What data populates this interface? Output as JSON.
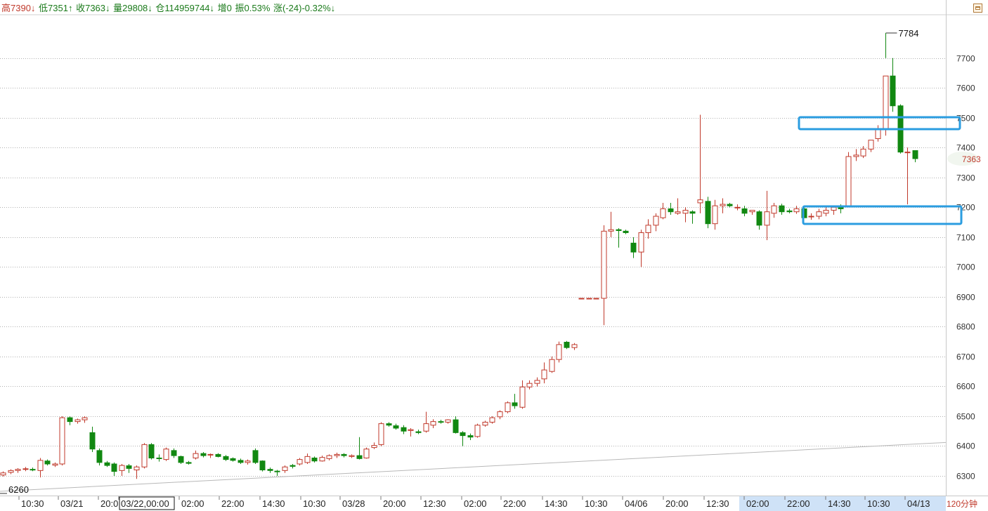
{
  "info": {
    "high_label": "高7390↓",
    "low_label": "低7351↑",
    "close_label": "收7363↓",
    "volume_label": "量29808↓",
    "position_label": "仓114959744↓",
    "increase_label": "增0",
    "amplitude_label": "振0.53%",
    "change_label": "涨(-24)-0.32%↓"
  },
  "period_label": "120分钟",
  "colors": {
    "up": "#c0392b",
    "down": "#118811",
    "highlight": "#2b9de0",
    "grid": "#b0b0b0"
  },
  "chart_data": {
    "type": "candlestick",
    "ylim": [
      6280,
      7820
    ],
    "y_ticks": [
      6300,
      6400,
      6500,
      6600,
      6700,
      6800,
      6900,
      7000,
      7100,
      7200,
      7300,
      7400,
      7500,
      7600,
      7700
    ],
    "x_tick_labels": [
      "10:30",
      "03/21",
      "20:0",
      "03/22,00:00",
      "02:00",
      "22:00",
      "14:30",
      "10:30",
      "03/28",
      "20:00",
      "12:30",
      "02:00",
      "22:00",
      "14:30",
      "10:30",
      "04/06",
      "20:00",
      "12:30",
      "02:00",
      "22:00",
      "14:30",
      "10:30",
      "04/13"
    ],
    "selected_x_label": "03/22,00:00",
    "annotations": {
      "max_label": "7784",
      "min_label": "6260",
      "last_price_label": "7363"
    },
    "last_price": 7363,
    "max_price": 7784,
    "min_price": 6260,
    "candles": [
      [
        6303,
        6315,
        6298,
        6310
      ],
      [
        6312,
        6322,
        6306,
        6318
      ],
      [
        6318,
        6326,
        6310,
        6322
      ],
      [
        6322,
        6330,
        6316,
        6324
      ],
      [
        6322,
        6328,
        6316,
        6320
      ],
      [
        6318,
        6360,
        6295,
        6352
      ],
      [
        6350,
        6355,
        6335,
        6340
      ],
      [
        6336,
        6345,
        6330,
        6340
      ],
      [
        6340,
        6500,
        6335,
        6495
      ],
      [
        6495,
        6500,
        6470,
        6482
      ],
      [
        6482,
        6492,
        6475,
        6488
      ],
      [
        6488,
        6500,
        6478,
        6495
      ],
      [
        6445,
        6465,
        6380,
        6390
      ],
      [
        6385,
        6392,
        6335,
        6345
      ],
      [
        6344,
        6350,
        6330,
        6335
      ],
      [
        6340,
        6345,
        6300,
        6315
      ],
      [
        6318,
        6340,
        6300,
        6335
      ],
      [
        6334,
        6340,
        6310,
        6325
      ],
      [
        6320,
        6335,
        6290,
        6330
      ],
      [
        6330,
        6410,
        6325,
        6405
      ],
      [
        6405,
        6410,
        6355,
        6360
      ],
      [
        6360,
        6372,
        6348,
        6358
      ],
      [
        6355,
        6395,
        6350,
        6390
      ],
      [
        6385,
        6392,
        6360,
        6368
      ],
      [
        6365,
        6368,
        6340,
        6345
      ],
      [
        6345,
        6350,
        6338,
        6342
      ],
      [
        6360,
        6385,
        6355,
        6375
      ],
      [
        6375,
        6380,
        6362,
        6368
      ],
      [
        6370,
        6375,
        6360,
        6372
      ],
      [
        6372,
        6376,
        6362,
        6365
      ],
      [
        6365,
        6370,
        6350,
        6355
      ],
      [
        6358,
        6362,
        6348,
        6352
      ],
      [
        6352,
        6358,
        6340,
        6345
      ],
      [
        6345,
        6355,
        6338,
        6350
      ],
      [
        6385,
        6392,
        6340,
        6345
      ],
      [
        6350,
        6352,
        6315,
        6320
      ],
      [
        6322,
        6328,
        6310,
        6318
      ],
      [
        6316,
        6320,
        6300,
        6315
      ],
      [
        6318,
        6335,
        6310,
        6330
      ],
      [
        6335,
        6340,
        6325,
        6332
      ],
      [
        6340,
        6360,
        6335,
        6355
      ],
      [
        6345,
        6375,
        6340,
        6365
      ],
      [
        6360,
        6365,
        6345,
        6350
      ],
      [
        6350,
        6368,
        6348,
        6362
      ],
      [
        6358,
        6372,
        6352,
        6368
      ],
      [
        6368,
        6378,
        6360,
        6372
      ],
      [
        6372,
        6376,
        6362,
        6368
      ],
      [
        6365,
        6372,
        6360,
        6368
      ],
      [
        6368,
        6430,
        6355,
        6358
      ],
      [
        6360,
        6395,
        6358,
        6390
      ],
      [
        6395,
        6412,
        6390,
        6402
      ],
      [
        6405,
        6480,
        6400,
        6475
      ],
      [
        6475,
        6480,
        6465,
        6470
      ],
      [
        6468,
        6475,
        6455,
        6460
      ],
      [
        6462,
        6470,
        6440,
        6450
      ],
      [
        6452,
        6460,
        6432,
        6455
      ],
      [
        6448,
        6455,
        6440,
        6445
      ],
      [
        6450,
        6515,
        6445,
        6475
      ],
      [
        6470,
        6490,
        6460,
        6482
      ],
      [
        6482,
        6488,
        6475,
        6480
      ],
      [
        6480,
        6490,
        6475,
        6488
      ],
      [
        6488,
        6500,
        6442,
        6445
      ],
      [
        6445,
        6450,
        6400,
        6435
      ],
      [
        6435,
        6442,
        6420,
        6430
      ],
      [
        6432,
        6475,
        6428,
        6470
      ],
      [
        6470,
        6485,
        6465,
        6480
      ],
      [
        6480,
        6500,
        6475,
        6495
      ],
      [
        6498,
        6520,
        6490,
        6515
      ],
      [
        6515,
        6550,
        6510,
        6545
      ],
      [
        6545,
        6575,
        6525,
        6535
      ],
      [
        6530,
        6620,
        6525,
        6598
      ],
      [
        6598,
        6620,
        6590,
        6610
      ],
      [
        6610,
        6630,
        6600,
        6620
      ],
      [
        6625,
        6680,
        6610,
        6655
      ],
      [
        6650,
        6700,
        6645,
        6690
      ],
      [
        6690,
        6750,
        6680,
        6740
      ],
      [
        6748,
        6752,
        6725,
        6730
      ],
      [
        6730,
        6745,
        6722,
        6740
      ],
      [
        6895,
        6895,
        6895,
        6895
      ],
      [
        6895,
        6895,
        6895,
        6895
      ],
      [
        6895,
        6895,
        6895,
        6895
      ],
      [
        6895,
        7140,
        6805,
        7120
      ],
      [
        7120,
        7185,
        7100,
        7125
      ],
      [
        7125,
        7130,
        7065,
        7122
      ],
      [
        7120,
        7125,
        7110,
        7115
      ],
      [
        7080,
        7100,
        7030,
        7050
      ],
      [
        7050,
        7125,
        7000,
        7115
      ],
      [
        7115,
        7160,
        7095,
        7140
      ],
      [
        7140,
        7180,
        7120,
        7170
      ],
      [
        7165,
        7215,
        7160,
        7195
      ],
      [
        7195,
        7215,
        7175,
        7185
      ],
      [
        7180,
        7230,
        7175,
        7185
      ],
      [
        7180,
        7200,
        7150,
        7190
      ],
      [
        7185,
        7190,
        7145,
        7180
      ],
      [
        7215,
        7510,
        7180,
        7225
      ],
      [
        7220,
        7235,
        7130,
        7145
      ],
      [
        7145,
        7225,
        7125,
        7205
      ],
      [
        7205,
        7230,
        7180,
        7210
      ],
      [
        7210,
        7215,
        7200,
        7205
      ],
      [
        7200,
        7210,
        7190,
        7200
      ],
      [
        7195,
        7205,
        7170,
        7180
      ],
      [
        7185,
        7190,
        7175,
        7190
      ],
      [
        7185,
        7190,
        7125,
        7140
      ],
      [
        7140,
        7255,
        7090,
        7185
      ],
      [
        7180,
        7215,
        7165,
        7205
      ],
      [
        7205,
        7212,
        7175,
        7185
      ],
      [
        7188,
        7195,
        7180,
        7185
      ],
      [
        7185,
        7205,
        7178,
        7195
      ],
      [
        7195,
        7200,
        7165,
        7165
      ],
      [
        7168,
        7180,
        7158,
        7170
      ],
      [
        7170,
        7195,
        7160,
        7185
      ],
      [
        7180,
        7200,
        7170,
        7190
      ],
      [
        7190,
        7205,
        7175,
        7200
      ],
      [
        7200,
        7210,
        7180,
        7195
      ],
      [
        7205,
        7385,
        7200,
        7370
      ],
      [
        7370,
        7395,
        7355,
        7375
      ],
      [
        7372,
        7405,
        7365,
        7395
      ],
      [
        7395,
        7425,
        7385,
        7425
      ],
      [
        7430,
        7475,
        7420,
        7460
      ],
      [
        7460,
        7640,
        7440,
        7640
      ],
      [
        7640,
        7700,
        7520,
        7540
      ],
      [
        7540,
        7545,
        7380,
        7385
      ],
      [
        7385,
        7400,
        7210,
        7385
      ],
      [
        7390,
        7390,
        7351,
        7363
      ]
    ]
  }
}
